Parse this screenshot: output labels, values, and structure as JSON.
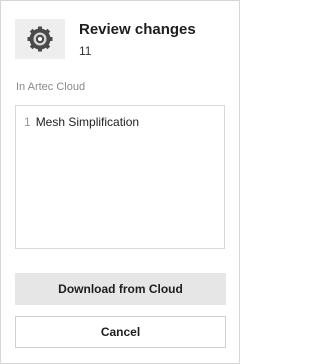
{
  "header": {
    "icon": "gear-badge-icon",
    "title": "Review changes",
    "count": "11"
  },
  "section": {
    "label": "In Artec Cloud"
  },
  "list": {
    "items": [
      {
        "number": "1",
        "label": "Mesh Simplification"
      }
    ]
  },
  "buttons": {
    "download_label": "Download from Cloud",
    "cancel_label": "Cancel"
  },
  "colors": {
    "icon_tile": "#eeeeee",
    "primary_button": "#e6e6e6",
    "border": "#d9d9d9",
    "muted_text": "#8a8a8a"
  }
}
